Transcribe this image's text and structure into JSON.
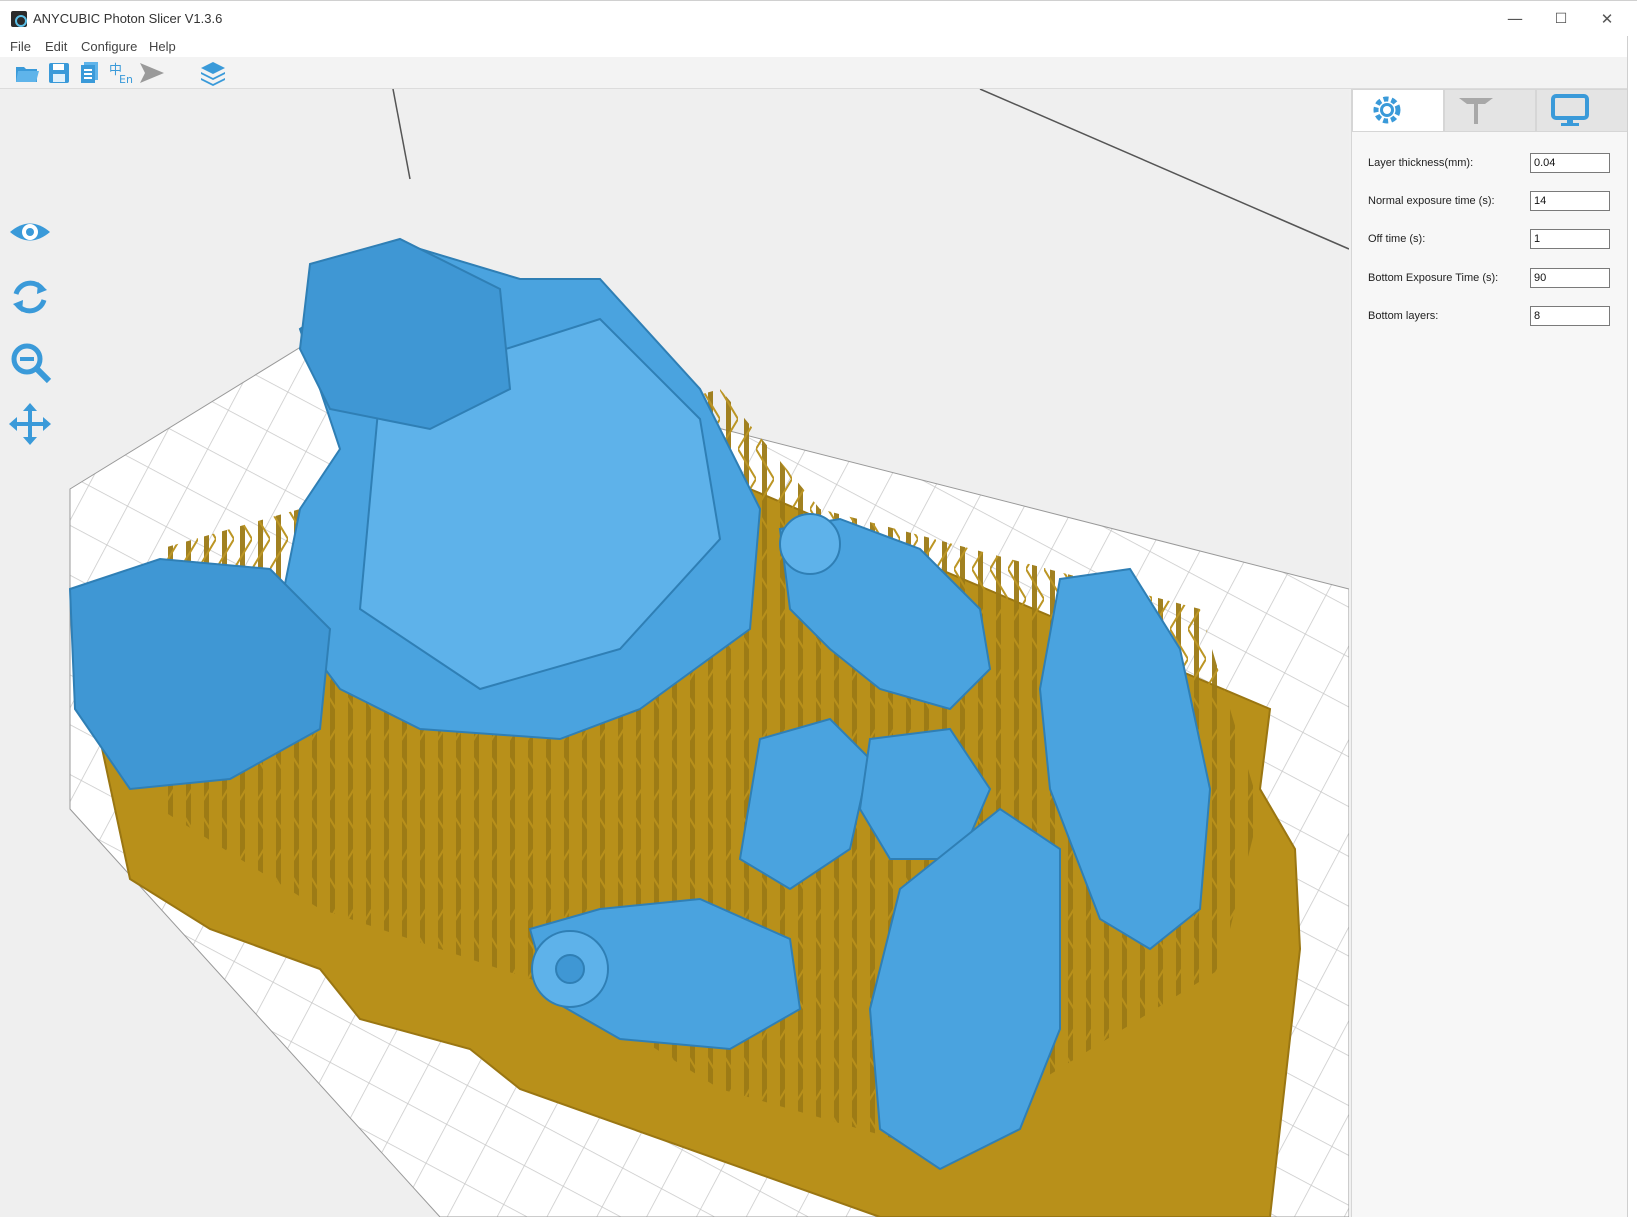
{
  "window": {
    "title": "ANYCUBIC Photon Slicer V1.3.6",
    "minimize": "—",
    "maximize": "☐",
    "close": "✕"
  },
  "menu": {
    "items": [
      "File",
      "Edit",
      "Configure",
      "Help"
    ]
  },
  "toolbar": {
    "icons": [
      "open-folder-icon",
      "save-icon",
      "export-icon",
      "language-icon",
      "send-icon",
      "layers-icon"
    ]
  },
  "left_tools": {
    "icons": [
      "eye-icon",
      "rotate-icon",
      "zoom-icon",
      "move-icon"
    ]
  },
  "panel": {
    "tabs": [
      "settings-gear-icon",
      "support-icon",
      "display-icon"
    ],
    "params": [
      {
        "label": "Layer thickness(mm):",
        "value": "0.04"
      },
      {
        "label": "Normal exposure time (s):",
        "value": "14"
      },
      {
        "label": "Off time (s):",
        "value": "1"
      },
      {
        "label": "Bottom Exposure Time (s):",
        "value": "90"
      },
      {
        "label": "Bottom layers:",
        "value": "8"
      }
    ]
  },
  "colors": {
    "accent": "#3a9ad9",
    "model": "#4aa3df",
    "support": "#b08a1e",
    "plate": "#b8901a",
    "grid": "#c8c8c8"
  }
}
